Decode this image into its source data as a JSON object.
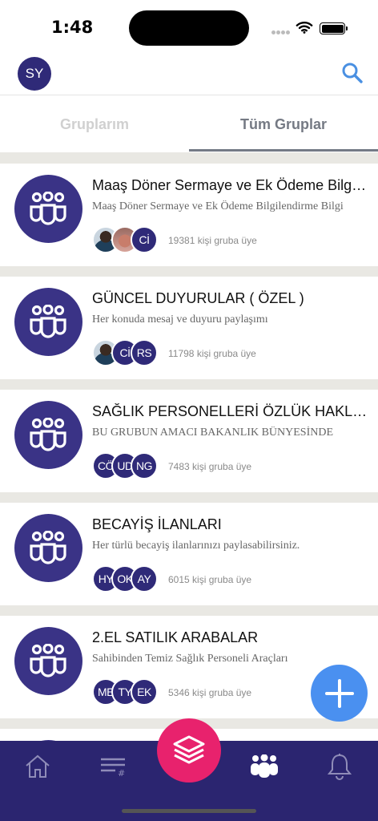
{
  "status": {
    "time": "1:48"
  },
  "header": {
    "avatar_initials": "SY"
  },
  "tabs": [
    {
      "label": "Gruplarım",
      "active": false
    },
    {
      "label": "Tüm Gruplar",
      "active": true
    }
  ],
  "groups": [
    {
      "title": "Maaş Döner Sermaye ve Ek Ödeme Bilgilendirme",
      "description": "Maaş Döner Sermaye ve Ek Ödeme Bilgilendirme Bilgi",
      "members": [
        {
          "type": "photo"
        },
        {
          "type": "photo"
        },
        {
          "type": "initials",
          "text": "Cİ"
        }
      ],
      "member_count": "19381 kişi gruba üye"
    },
    {
      "title": "GÜNCEL DUYURULAR ( ÖZEL )",
      "description": "Her konuda mesaj ve duyuru paylaşımı",
      "members": [
        {
          "type": "photo"
        },
        {
          "type": "initials",
          "text": "Cİ"
        },
        {
          "type": "initials",
          "text": "RS"
        }
      ],
      "member_count": "11798 kişi gruba üye"
    },
    {
      "title": "SAĞLIK PERSONELLERİ ÖZLÜK HAKLARI",
      "description": "BU GRUBUN AMACI BAKANLIK BÜNYESİNDE",
      "members": [
        {
          "type": "initials",
          "text": "CÖ"
        },
        {
          "type": "initials",
          "text": "UD"
        },
        {
          "type": "initials",
          "text": "NG"
        }
      ],
      "member_count": "7483 kişi gruba üye"
    },
    {
      "title": "BECAYİŞ İLANLARI",
      "description": "Her türlü becayiş ilanlarınızı paylasabilirsiniz.",
      "members": [
        {
          "type": "initials",
          "text": "HY"
        },
        {
          "type": "initials",
          "text": "OK"
        },
        {
          "type": "initials",
          "text": "AY"
        }
      ],
      "member_count": "6015 kişi gruba üye"
    },
    {
      "title": "2.EL SATILIK ARABALAR",
      "description": "Sahibinden Temiz Sağlık Personeli Araçları",
      "members": [
        {
          "type": "initials",
          "text": "ME"
        },
        {
          "type": "initials",
          "text": "TY"
        },
        {
          "type": "initials",
          "text": "EK"
        }
      ],
      "member_count": "5346 kişi gruba üye"
    }
  ],
  "icons": {
    "search": "search-icon",
    "fab": "plus-icon",
    "center": "layers-icon",
    "nav": [
      "home-icon",
      "feed-list-icon",
      "groups-icon",
      "bell-icon"
    ]
  },
  "colors": {
    "brand": "#2f2a78",
    "nav_bg": "#2b2570",
    "fab": "#4a90f0",
    "center_button": "#e8226d",
    "search": "#4a90e2"
  }
}
